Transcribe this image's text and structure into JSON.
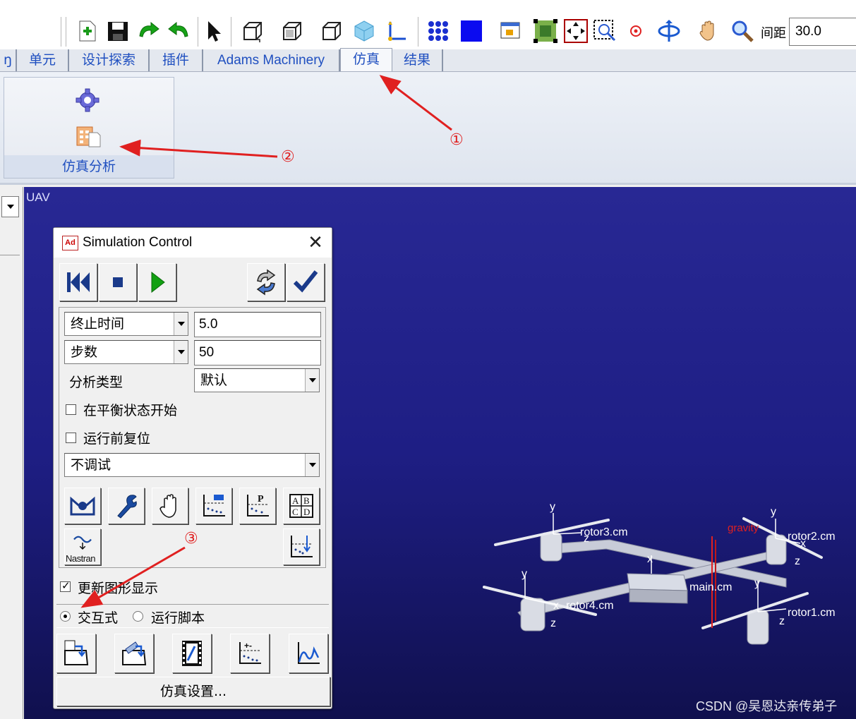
{
  "toolbar": {
    "icons": [
      "new-icon",
      "save-icon",
      "redo-icon",
      "undo-icon",
      "select-arrow-icon",
      "view-front-icon",
      "view-right-icon",
      "view-top-icon",
      "view-iso-icon",
      "axes-icon",
      "grid-icon",
      "render-icon",
      "window-icon",
      "fit-icon",
      "fit-all-icon",
      "zoom-box-icon",
      "center-icon",
      "rotate-icon",
      "pan-icon",
      "zoom-icon"
    ],
    "spacing_label": "间距",
    "spacing_value": "30.0"
  },
  "tabs": [
    {
      "label": "单元"
    },
    {
      "label": "设计探索"
    },
    {
      "label": "插件"
    },
    {
      "label": "Adams Machinery"
    },
    {
      "label": "仿真",
      "active": true
    },
    {
      "label": "结果"
    }
  ],
  "ribbon": {
    "group_label": "仿真分析"
  },
  "model": {
    "name": "UAV",
    "markers": {
      "rotor1": "rotor1.cm",
      "rotor2": "rotor2.cm",
      "rotor3": "rotor3.cm",
      "rotor4": "rotor4.cm",
      "main": "main.cm",
      "gravity": "gravity"
    },
    "axis_x": "x",
    "axis_y": "y",
    "axis_z": "z"
  },
  "dialog": {
    "icon_text": "Ad",
    "title": "Simulation Control",
    "end_mode": "终止时间",
    "end_value": "5.0",
    "steps_mode": "步数",
    "steps_value": "50",
    "analysis_type_label": "分析类型",
    "analysis_type_value": "默认",
    "start_equilibrium_label": "在平衡状态开始",
    "start_equilibrium_checked": false,
    "reset_before_run_label": "运行前复位",
    "reset_before_run_checked": false,
    "debug_value": "不调试",
    "nastran_label": "Nastran",
    "update_graphics_label": "更新图形显示",
    "update_graphics_checked": true,
    "interactive_label": "交互式",
    "script_label": "运行脚本",
    "mode": "interactive",
    "settings_button": "仿真设置..."
  },
  "annotations": {
    "one": "①",
    "two": "②",
    "three": "③",
    "color": "#e02020"
  },
  "watermark": "CSDN @吴恩达亲传弟子"
}
